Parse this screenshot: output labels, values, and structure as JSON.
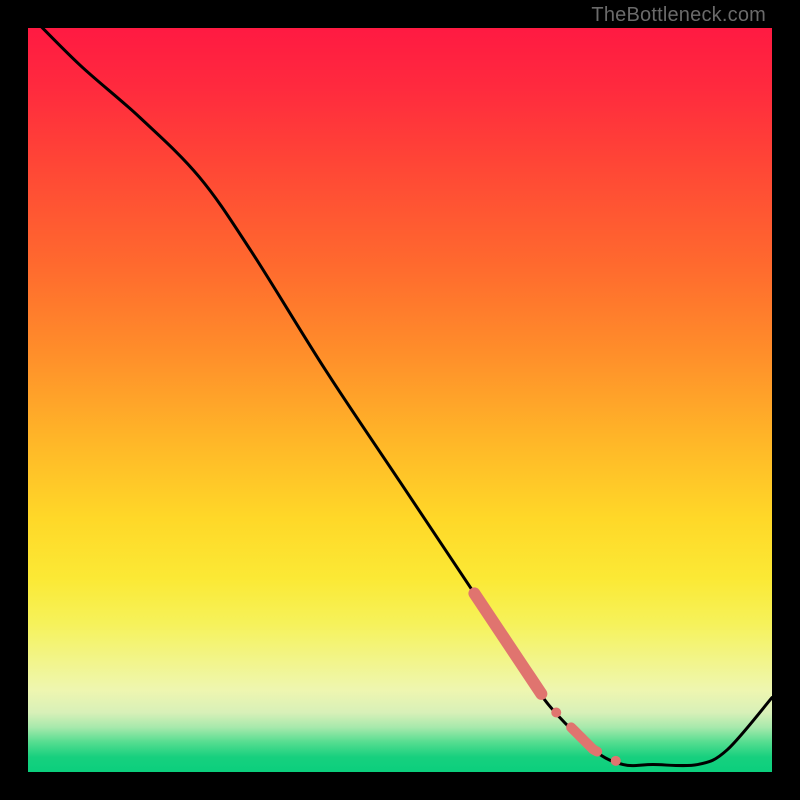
{
  "watermark": {
    "text": "TheBottleneck.com"
  },
  "colors": {
    "curve": "#000000",
    "marker": "#e0746f",
    "frame_bg": "#000000"
  },
  "chart_data": {
    "type": "line",
    "title": "",
    "xlabel": "",
    "ylabel": "",
    "xlim": [
      0,
      100
    ],
    "ylim": [
      0,
      100
    ],
    "grid": false,
    "legend": false,
    "series": [
      {
        "name": "curve",
        "x": [
          0,
          7,
          15,
          23,
          30,
          40,
          50,
          60,
          66,
          70,
          76,
          80,
          84,
          90,
          94,
          100
        ],
        "y": [
          102,
          95,
          88,
          80,
          70,
          54,
          39,
          24,
          15,
          9,
          3,
          1,
          1,
          1,
          3,
          10
        ]
      }
    ],
    "markers": {
      "segments": [
        {
          "x_start": 60.0,
          "x_end": 69.0,
          "thickness": 12
        },
        {
          "x_start": 73.0,
          "x_end": 76.5,
          "thickness": 10
        }
      ],
      "points": [
        {
          "x": 71.0,
          "r": 5
        },
        {
          "x": 79.0,
          "r": 5
        }
      ]
    }
  }
}
